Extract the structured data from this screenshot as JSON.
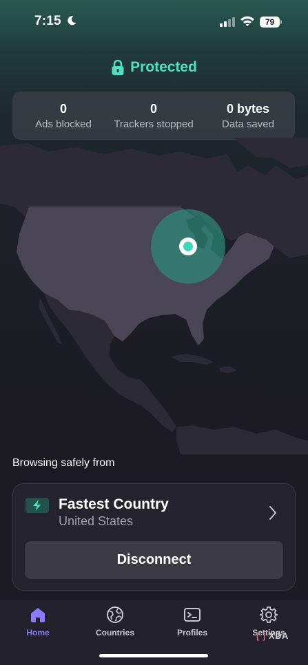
{
  "status_bar": {
    "time": "7:15",
    "battery": "79"
  },
  "protection": {
    "status": "Protected",
    "accent_color": "#4ee0c0"
  },
  "stats": [
    {
      "value": "0",
      "label": "Ads blocked"
    },
    {
      "value": "0",
      "label": "Trackers stopped"
    },
    {
      "value": "0 bytes",
      "label": "Data saved"
    }
  ],
  "location": {
    "heading": "Browsing safely from",
    "server_title": "Fastest Country",
    "server_country": "United States",
    "disconnect_label": "Disconnect"
  },
  "tabs": [
    {
      "label": "Home",
      "icon": "home-icon",
      "active": true
    },
    {
      "label": "Countries",
      "icon": "globe-icon",
      "active": false
    },
    {
      "label": "Profiles",
      "icon": "terminal-icon",
      "active": false
    },
    {
      "label": "Settings",
      "icon": "gear-icon",
      "active": false
    }
  ],
  "watermark": {
    "text": "XDA"
  },
  "colors": {
    "active_tab": "#8b7bff",
    "background": "#1c1b23",
    "map_land": "#2c2a35",
    "map_usa": "#4a4656"
  }
}
